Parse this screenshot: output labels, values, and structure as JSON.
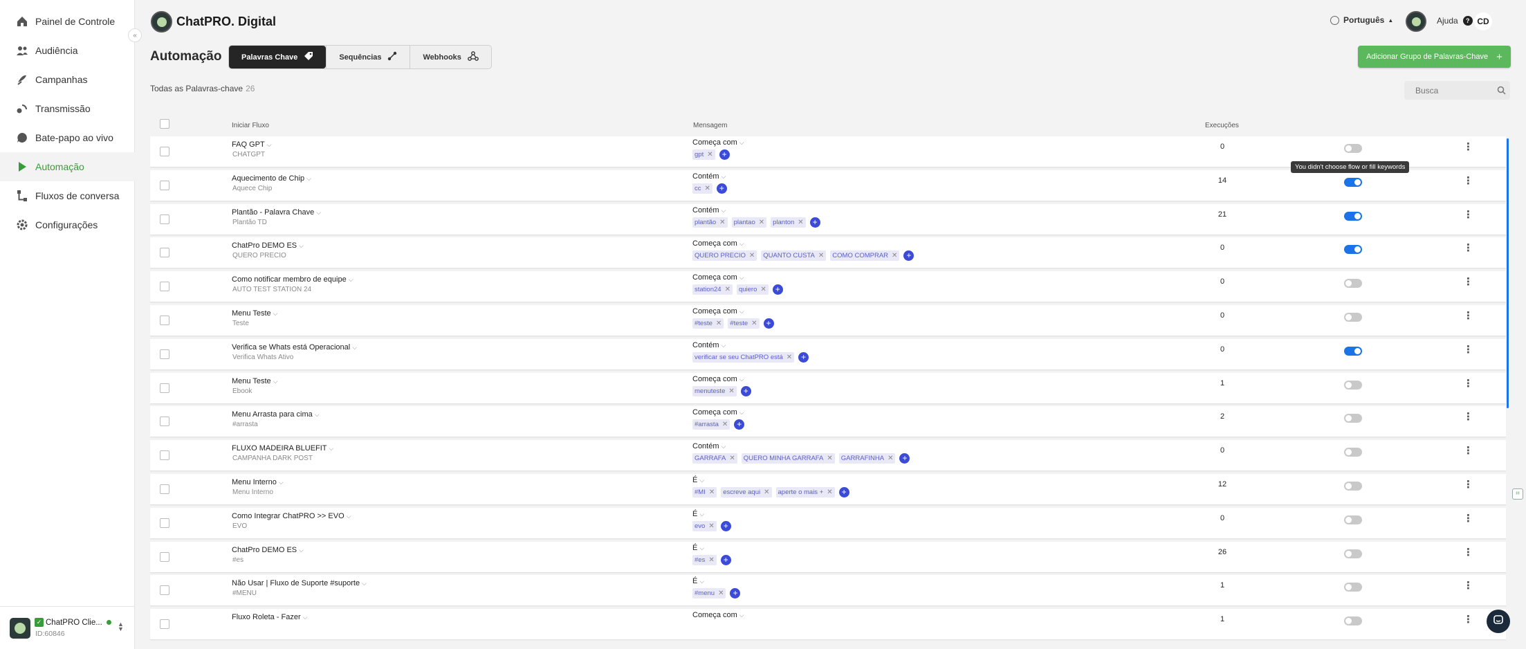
{
  "app": {
    "title": "ChatPRO. Digital"
  },
  "sidebar": {
    "items": [
      {
        "label": "Painel de Controle",
        "icon": "home-icon"
      },
      {
        "label": "Audiência",
        "icon": "users-icon"
      },
      {
        "label": "Campanhas",
        "icon": "campaign-icon"
      },
      {
        "label": "Transmissão",
        "icon": "broadcast-icon"
      },
      {
        "label": "Bate-papo ao vivo",
        "icon": "chat-icon"
      },
      {
        "label": "Automação",
        "icon": "play-icon"
      },
      {
        "label": "Fluxos de conversa",
        "icon": "flow-icon"
      },
      {
        "label": "Configurações",
        "icon": "gear-icon"
      }
    ],
    "active_color": "#3a9b3a",
    "account": {
      "name": "ChatPRO Clie...",
      "id": "ID:60846"
    }
  },
  "header": {
    "language": "Português",
    "help": "Ajuda",
    "user_initials": "CD"
  },
  "page": {
    "title": "Automação",
    "tabs": [
      "Palavras Chave",
      "Sequências",
      "Webhooks"
    ],
    "add_button": "Adicionar Grupo de Palavras-Chave",
    "count_label": "Todas as Palavras-chave",
    "count": "26",
    "search_placeholder": "Busca"
  },
  "table": {
    "headers": {
      "flow": "Iniciar Fluxo",
      "message": "Mensagem",
      "executions": "Execuções"
    },
    "tooltip": "You didn't choose flow or fill keywords",
    "rows": [
      {
        "name": "FAQ GPT",
        "sub": "CHATGPT",
        "match": "Começa com",
        "keywords": [
          "gpt"
        ],
        "execs": "0",
        "on": false
      },
      {
        "name": "Aquecimento de Chip",
        "sub": "Aquece Chip",
        "match": "Contém",
        "keywords": [
          "cc"
        ],
        "execs": "14",
        "on": true
      },
      {
        "name": "Plantão - Palavra Chave",
        "sub": "Plantão TD",
        "match": "Contém",
        "keywords": [
          "plantão",
          "plantao",
          "planton"
        ],
        "execs": "21",
        "on": true
      },
      {
        "name": "ChatPro DEMO ES",
        "sub": "QUERO PRECIO",
        "match": "Começa com",
        "keywords": [
          "QUERO PRECIO",
          "QUANTO CUSTA",
          "COMO COMPRAR"
        ],
        "execs": "0",
        "on": true
      },
      {
        "name": "Como notificar membro de equipe",
        "sub": "AUTO TEST STATION 24",
        "match": "Começa com",
        "keywords": [
          "station24",
          "quiero"
        ],
        "execs": "0",
        "on": false
      },
      {
        "name": "Menu Teste",
        "sub": "Teste",
        "match": "Começa com",
        "keywords": [
          "#teste",
          "#teste"
        ],
        "execs": "0",
        "on": false
      },
      {
        "name": "Verifica se Whats está Operacional",
        "sub": "Verifica Whats Ativo",
        "match": "Contém",
        "keywords": [
          "verificar se seu ChatPRO está"
        ],
        "execs": "0",
        "on": true
      },
      {
        "name": "Menu Teste",
        "sub": "Ebook",
        "match": "Começa com",
        "keywords": [
          "menuteste"
        ],
        "execs": "1",
        "on": false
      },
      {
        "name": "Menu Arrasta para cima",
        "sub": "#arrasta",
        "match": "Começa com",
        "keywords": [
          "#arrasta"
        ],
        "execs": "2",
        "on": false
      },
      {
        "name": "FLUXO MADEIRA BLUEFIT",
        "sub": "CAMPANHA DARK POST",
        "match": "Contém",
        "keywords": [
          "GARRAFA",
          "QUERO MINHA GARRAFA",
          "GARRAFINHA"
        ],
        "execs": "0",
        "on": false
      },
      {
        "name": "Menu Interno",
        "sub": "Menu Interno",
        "match": "É",
        "keywords": [
          "#MI",
          "escreve aqui",
          "aperte o mais +"
        ],
        "execs": "12",
        "on": false
      },
      {
        "name": "Como Integrar ChatPRO >> EVO",
        "sub": "EVO",
        "match": "É",
        "keywords": [
          "evo"
        ],
        "execs": "0",
        "on": false
      },
      {
        "name": "ChatPro DEMO ES",
        "sub": "#es",
        "match": "É",
        "keywords": [
          "#es"
        ],
        "execs": "26",
        "on": false
      },
      {
        "name": "Não Usar | Fluxo de Suporte #suporte",
        "sub": "#MENU",
        "match": "É",
        "keywords": [
          "#menu"
        ],
        "execs": "1",
        "on": false
      },
      {
        "name": "Fluxo Roleta - Fazer",
        "sub": "",
        "match": "Começa com",
        "keywords": [],
        "execs": "1",
        "on": false
      }
    ]
  }
}
